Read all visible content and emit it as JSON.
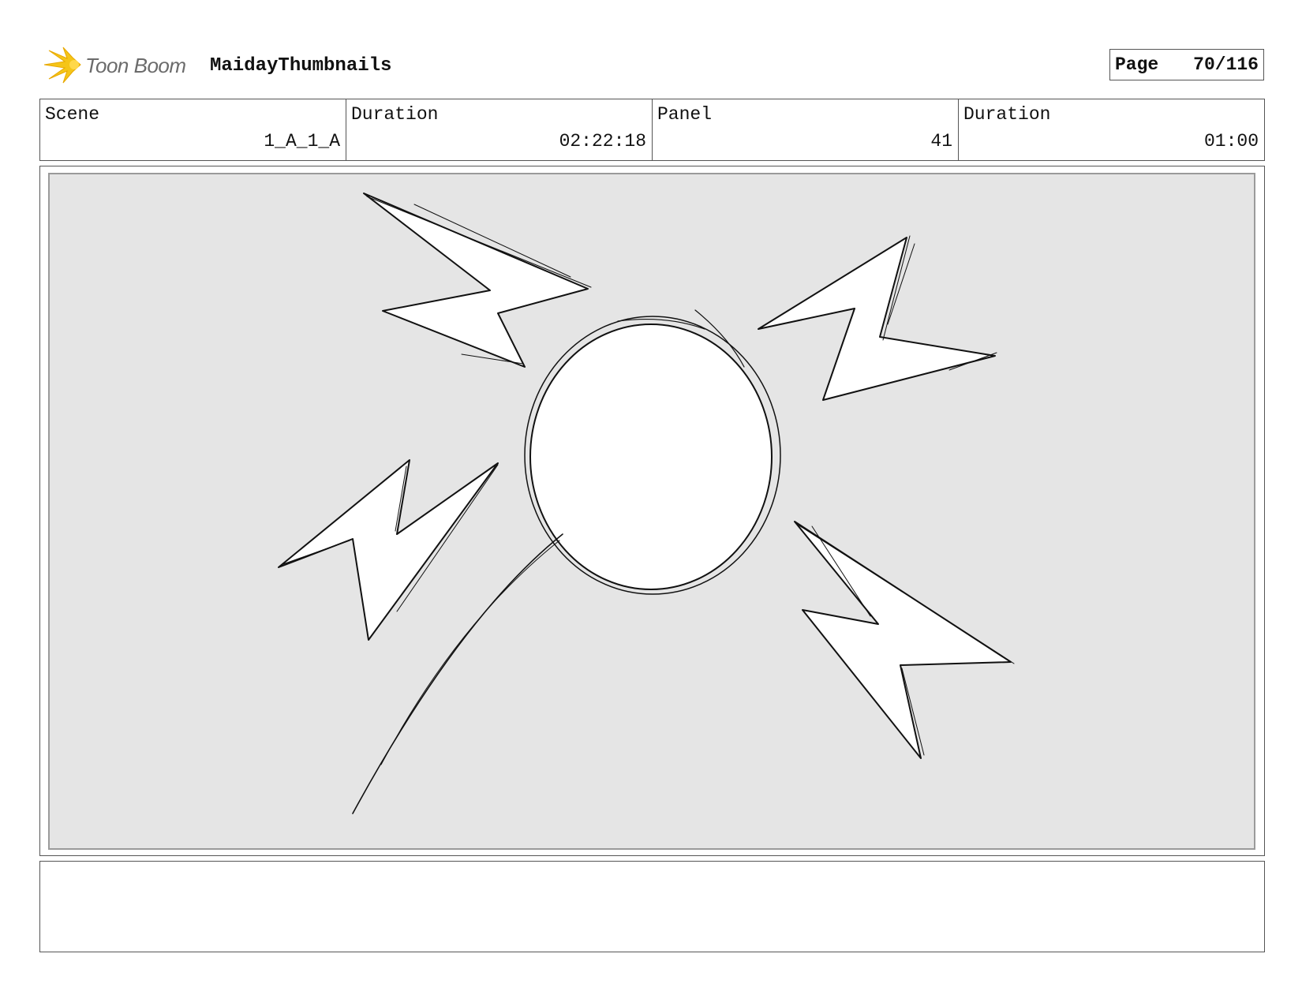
{
  "header": {
    "logo_text": "Toon Boom",
    "project_title": "MaidayThumbnails",
    "page_label": "Page",
    "page_number": "70/116"
  },
  "info": {
    "scene_label": "Scene",
    "scene_value": "1_A_1_A",
    "scene_duration_label": "Duration",
    "scene_duration_value": "02:22:18",
    "panel_label": "Panel",
    "panel_value": "41",
    "panel_duration_label": "Duration",
    "panel_duration_value": "01:00"
  },
  "panel": {
    "background_color": "#e5e5e5",
    "sketch_stroke_color": "#111111"
  },
  "notes": {
    "text": ""
  },
  "colors": {
    "logo_accent": "#f5c518",
    "border": "#555555"
  }
}
